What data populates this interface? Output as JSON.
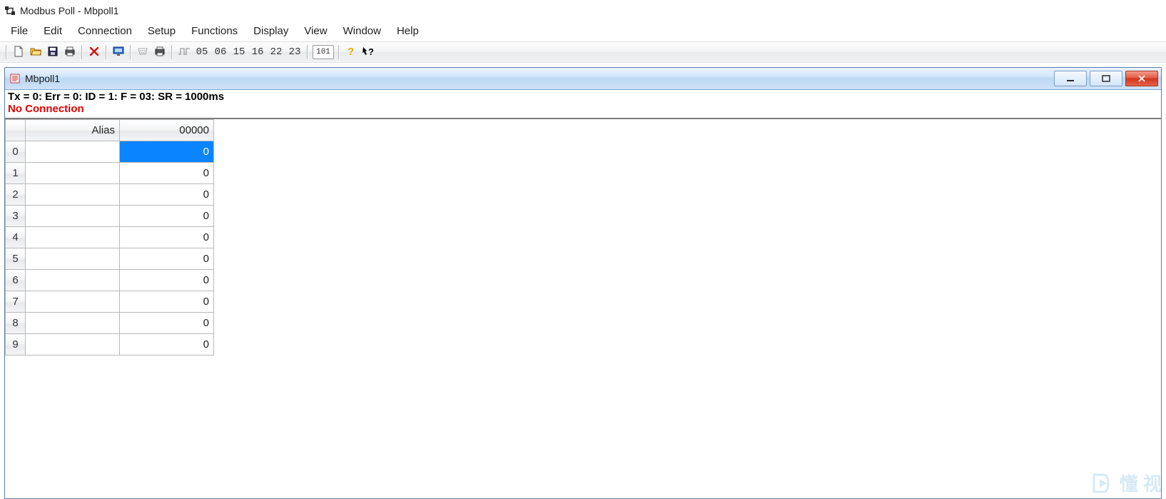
{
  "window": {
    "title": "Modbus Poll - Mbpoll1"
  },
  "menu": {
    "items": [
      "File",
      "Edit",
      "Connection",
      "Setup",
      "Functions",
      "Display",
      "View",
      "Window",
      "Help"
    ]
  },
  "toolbar": {
    "fn_codes": [
      "05",
      "06",
      "15",
      "16",
      "22",
      "23"
    ],
    "addr_box": "101"
  },
  "child": {
    "title": "Mbpoll1",
    "status_line": "Tx = 0: Err = 0: ID = 1: F = 03: SR = 1000ms",
    "no_connection": "No Connection",
    "headers": {
      "alias": "Alias",
      "value": "00000"
    },
    "rows": [
      {
        "idx": "0",
        "alias": "",
        "value": "0",
        "selected": true
      },
      {
        "idx": "1",
        "alias": "",
        "value": "0",
        "selected": false
      },
      {
        "idx": "2",
        "alias": "",
        "value": "0",
        "selected": false
      },
      {
        "idx": "3",
        "alias": "",
        "value": "0",
        "selected": false
      },
      {
        "idx": "4",
        "alias": "",
        "value": "0",
        "selected": false
      },
      {
        "idx": "5",
        "alias": "",
        "value": "0",
        "selected": false
      },
      {
        "idx": "6",
        "alias": "",
        "value": "0",
        "selected": false
      },
      {
        "idx": "7",
        "alias": "",
        "value": "0",
        "selected": false
      },
      {
        "idx": "8",
        "alias": "",
        "value": "0",
        "selected": false
      },
      {
        "idx": "9",
        "alias": "",
        "value": "0",
        "selected": false
      }
    ]
  },
  "watermark": {
    "text": "懂 视"
  }
}
